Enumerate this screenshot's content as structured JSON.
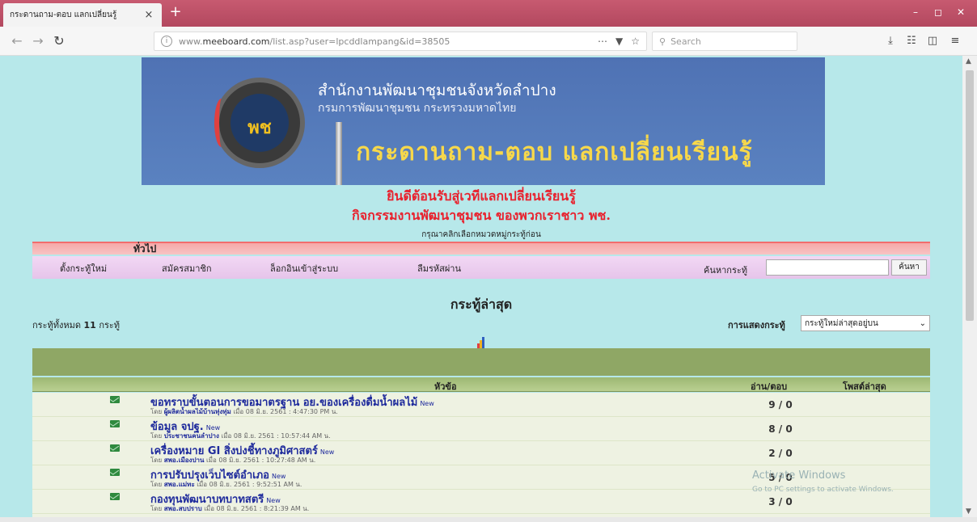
{
  "browser": {
    "tab_title": "กระดานถาม-ตอบ แลกเปลี่ยนรู้",
    "tab_close": "×",
    "new_tab": "+",
    "url_prefix": "www.",
    "url_domain": "meeboard.com",
    "url_path": "/list.asp?user=lpcddlampang&id=38505",
    "search_placeholder": "Search",
    "accent_color": "#c75a70"
  },
  "banner": {
    "title1": "สำนักงานพัฒนาชุมชนจังหวัดลำปาง",
    "title2": "กรมการพัฒนาชุมชน กระทรวงมหาดไทย",
    "title3": "กระดานถาม-ตอบ แลกเปลี่ยนเรียนรู้",
    "logo_text": "พช"
  },
  "welcome": {
    "line1": "ยินดีต้อนรับสู่เวทีแลกเปลี่ยนเรียนรู้",
    "line2": "กิจกรรมงานพัฒนาชุมชน ของพวกเราชาว พช.",
    "choose_category": "กรุณาคลิกเลือกหมวดหมู่กระทู้ก่อน"
  },
  "category": {
    "general": "ทั่วไป"
  },
  "menu": {
    "new_topic": "ตั้งกระทู้ใหม่",
    "register": "สมัครสมาชิก",
    "login": "ล็อกอินเข้าสู่ระบบ",
    "forgot_password": "ลืมรหัสผ่าน",
    "search_label": "ค้นหากระทู้",
    "search_button": "ค้นหา"
  },
  "list": {
    "heading": "กระทู้ล่าสุด",
    "total_prefix": "กระทู้ทั้งหมด",
    "total_count": "11",
    "total_suffix": "กระทู้",
    "sort_label": "การแสดงกระทู้",
    "sort_value": "กระทู้ใหม่ล่าสุดอยู่บน",
    "col_title": "หัวข้อ",
    "col_read_reply": "อ่าน/ตอบ",
    "col_last_post": "โพสต์ล่าสุด"
  },
  "topics": [
    {
      "title": "ขอทราบขั้นตอนการขอมาตรฐาน อย.ของเครื่องดื่มน้ำผลไม้",
      "badge": "New",
      "by": "โดย",
      "author": "ผู้ผลิตน้ำผลไม้บ้านทุ่งทุ่ม",
      "date": "เมื่อ 08 มิ.ย. 2561 : 4:47:30 PM น.",
      "count": "9 / 0"
    },
    {
      "title": "ข้อมูล จปฐ.",
      "badge": "New",
      "by": "โดย",
      "author": "ประชาชนคนลำปาง",
      "date": "เมื่อ 08 มิ.ย. 2561 : 10:57:44 AM น.",
      "count": "8 / 0"
    },
    {
      "title": "เครื่องหมาย GI สิ่งบ่งชี้ทางภูมิศาสตร์",
      "badge": "New",
      "by": "โดย",
      "author": "สพอ.เมืองปาน",
      "date": "เมื่อ 08 มิ.ย. 2561 : 10:27:48 AM น.",
      "count": "2 / 0"
    },
    {
      "title": "การปรับปรุงเว็บไซต์อำเภอ",
      "badge": "New",
      "by": "โดย",
      "author": "สพอ.แม่ทะ",
      "date": "เมื่อ 08 มิ.ย. 2561 : 9:52:51 AM น.",
      "count": "5 / 0"
    },
    {
      "title": "กองทุนพัฒนาบทบาทสตรี",
      "badge": "New",
      "by": "โดย",
      "author": "สพอ.สบปราบ",
      "date": "เมื่อ 08 มิ.ย. 2561 : 8:21:39 AM น.",
      "count": "3 / 0"
    }
  ],
  "watermark": {
    "line1": "Activate Windows",
    "line2": "Go to PC settings to activate Windows."
  }
}
